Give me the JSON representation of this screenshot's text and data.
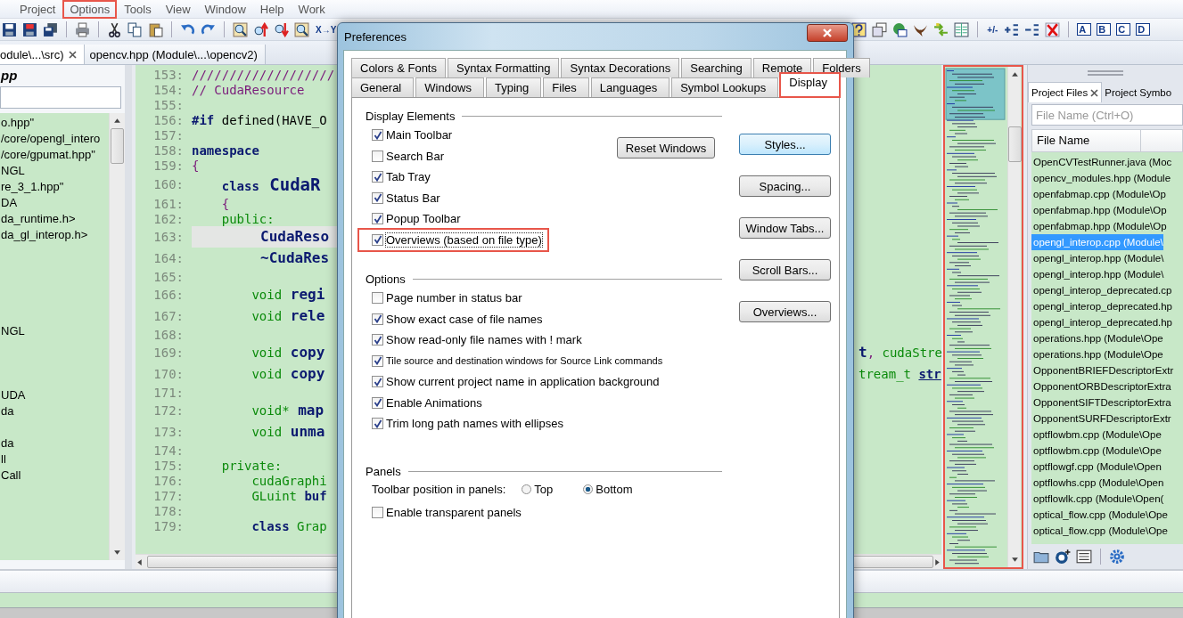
{
  "menu": [
    {
      "label": "Project",
      "highlighted": false
    },
    {
      "label": "Options",
      "highlighted": true
    },
    {
      "label": "Tools",
      "highlighted": false
    },
    {
      "label": "View",
      "highlighted": false
    },
    {
      "label": "Window",
      "highlighted": false
    },
    {
      "label": "Help",
      "highlighted": false
    },
    {
      "label": "Work",
      "highlighted": false
    }
  ],
  "toolbar": {
    "left": [
      {
        "kind": "floppy"
      },
      {
        "kind": "floppy-red"
      },
      {
        "kind": "floppies"
      },
      {
        "kind": "sep"
      },
      {
        "kind": "printer"
      },
      {
        "kind": "sep"
      },
      {
        "kind": "scissors"
      },
      {
        "kind": "copy"
      },
      {
        "kind": "paste"
      },
      {
        "kind": "sep"
      },
      {
        "kind": "undo"
      },
      {
        "kind": "redo"
      },
      {
        "kind": "sep"
      },
      {
        "kind": "find"
      },
      {
        "kind": "find-up"
      },
      {
        "kind": "find-down"
      },
      {
        "kind": "find"
      },
      {
        "kind": "label",
        "label": "X→Y"
      }
    ],
    "right": [
      {
        "kind": "help"
      },
      {
        "kind": "windows"
      },
      {
        "kind": "globe"
      },
      {
        "kind": "bird"
      },
      {
        "kind": "arrows"
      },
      {
        "kind": "columns"
      },
      {
        "kind": "sep"
      },
      {
        "kind": "label",
        "label": "+/-"
      },
      {
        "kind": "plus-list"
      },
      {
        "kind": "minus-list"
      },
      {
        "kind": "red-x"
      },
      {
        "kind": "sep"
      },
      {
        "kind": "letter",
        "label": "A"
      },
      {
        "kind": "letter",
        "label": "B"
      },
      {
        "kind": "letter",
        "label": "C"
      },
      {
        "kind": "letter",
        "label": "D"
      }
    ]
  },
  "file_tabs": [
    {
      "label": "odule\\...\\src)",
      "selected": true,
      "closable": true
    },
    {
      "label": "opencv.hpp (Module\\...\\opencv2)",
      "selected": false,
      "closable": false
    }
  ],
  "left_panel": {
    "title": "pp",
    "items": [
      {
        "kind": "entry",
        "text": "o.hpp\""
      },
      {
        "kind": "entry",
        "text": "/core/opengl_intero"
      },
      {
        "kind": "entry",
        "text": "/core/gpumat.hpp\""
      },
      {
        "kind": "entry",
        "text": "NGL"
      },
      {
        "kind": "entry",
        "text": "re_3_1.hpp\""
      },
      {
        "kind": "entry",
        "text": "DA"
      },
      {
        "kind": "entry",
        "text": "da_runtime.h>"
      },
      {
        "kind": "entry",
        "text": "da_gl_interop.h>"
      },
      {
        "kind": "offscreen"
      },
      {
        "kind": "offscreen"
      },
      {
        "kind": "offscreen"
      },
      {
        "kind": "offscreen"
      },
      {
        "kind": "offscreen"
      },
      {
        "kind": "entry",
        "text": "NGL"
      },
      {
        "kind": "offscreen"
      },
      {
        "kind": "offscreen"
      },
      {
        "kind": "offscreen"
      },
      {
        "kind": "entry",
        "text": "UDA"
      },
      {
        "kind": "entry",
        "text": "da"
      },
      {
        "kind": "offscreen"
      },
      {
        "kind": "entry",
        "text": "da"
      },
      {
        "kind": "entry",
        "text": "ll"
      },
      {
        "kind": "entry",
        "text": "Call"
      }
    ]
  },
  "editor": {
    "lines": [
      {
        "number": "153:",
        "segments": [
          {
            "kind": "comment",
            "text": "///////////////////"
          }
        ]
      },
      {
        "number": "154:",
        "segments": [
          {
            "kind": "comment",
            "text": "// CudaResource"
          }
        ]
      },
      {
        "number": "155:"
      },
      {
        "number": "156:",
        "segments": [
          {
            "kind": "keyword",
            "text": "#if"
          },
          {
            "kind": "plain",
            "text": " defined(HAVE_O"
          }
        ]
      },
      {
        "number": "157:"
      },
      {
        "number": "158:",
        "segments": [
          {
            "kind": "keyword",
            "text": "namespace"
          }
        ]
      },
      {
        "number": "159:",
        "segments": [
          {
            "kind": "comment",
            "text": "{"
          }
        ]
      },
      {
        "number": "160:",
        "segments": [
          {
            "kind": "keyword",
            "text": "    class"
          },
          {
            "kind": "title",
            "text": " CudaR"
          }
        ]
      },
      {
        "number": "161:",
        "segments": [
          {
            "kind": "comment",
            "text": "    {"
          }
        ]
      },
      {
        "number": "162:",
        "segments": [
          {
            "kind": "type",
            "text": "    public:"
          }
        ]
      },
      {
        "number": "163:",
        "current": true,
        "segments": [
          {
            "kind": "big",
            "text": "        CudaReso"
          }
        ]
      },
      {
        "number": "164:",
        "segments": [
          {
            "kind": "big",
            "text": "        ~CudaRes"
          }
        ]
      },
      {
        "number": "165:"
      },
      {
        "number": "166:",
        "segments": [
          {
            "kind": "type",
            "text": "        void"
          },
          {
            "kind": "big",
            "text": " regi"
          }
        ]
      },
      {
        "number": "167:",
        "segments": [
          {
            "kind": "type",
            "text": "        void"
          },
          {
            "kind": "big",
            "text": " rele"
          }
        ]
      },
      {
        "number": "168:"
      },
      {
        "number": "169:",
        "segments": [
          {
            "kind": "type",
            "text": "        void"
          },
          {
            "kind": "big",
            "text": " copy"
          }
        ],
        "right_segments": [
          {
            "kind": "big",
            "text": "t"
          },
          {
            "kind": "comment",
            "text": ","
          },
          {
            "kind": "type",
            "text": " cudaStre"
          }
        ]
      },
      {
        "number": "170:",
        "segments": [
          {
            "kind": "type",
            "text": "        void"
          },
          {
            "kind": "big",
            "text": " copy"
          }
        ],
        "right_segments": [
          {
            "kind": "type",
            "text": "tream_t "
          },
          {
            "kind": "link",
            "text": "str"
          }
        ]
      },
      {
        "number": "171:"
      },
      {
        "number": "172:",
        "segments": [
          {
            "kind": "type",
            "text": "        void*"
          },
          {
            "kind": "big",
            "text": " map"
          }
        ]
      },
      {
        "number": "173:",
        "segments": [
          {
            "kind": "type",
            "text": "        void"
          },
          {
            "kind": "big",
            "text": " unma"
          }
        ]
      },
      {
        "number": "174:"
      },
      {
        "number": "175:",
        "segments": [
          {
            "kind": "type",
            "text": "    private:"
          }
        ]
      },
      {
        "number": "176:",
        "segments": [
          {
            "kind": "type",
            "text": "        cudaGraphi"
          }
        ]
      },
      {
        "number": "177:",
        "segments": [
          {
            "kind": "type",
            "text": "        GLuint"
          },
          {
            "kind": "keyword",
            "text": " buf"
          }
        ]
      },
      {
        "number": "178:"
      },
      {
        "number": "179:",
        "segments": [
          {
            "kind": "keyword",
            "text": "        class"
          },
          {
            "kind": "type",
            "text": " Grap"
          }
        ]
      }
    ]
  },
  "overview": {
    "highlighted": true
  },
  "project_panel": {
    "tabs": [
      {
        "label": "Project Files",
        "selected": true,
        "closable": true
      },
      {
        "label": "Project Symbo",
        "selected": false,
        "closable": false
      }
    ],
    "search": {
      "placeholder": "File Name (Ctrl+O)"
    },
    "columns": [
      "File Name"
    ],
    "rows": [
      {
        "text": "OpenCVTestRunner.java (Moc",
        "selected": false
      },
      {
        "text": "opencv_modules.hpp (Module",
        "selected": false
      },
      {
        "text": "openfabmap.cpp (Module\\Op",
        "selected": false
      },
      {
        "text": "openfabmap.hpp (Module\\Op",
        "selected": false
      },
      {
        "text": "openfabmap.hpp (Module\\Op",
        "selected": false
      },
      {
        "text": "opengl_interop.cpp (Module\\",
        "selected": true
      },
      {
        "text": "opengl_interop.hpp (Module\\",
        "selected": false
      },
      {
        "text": "opengl_interop.hpp (Module\\",
        "selected": false
      },
      {
        "text": "opengl_interop_deprecated.cp",
        "selected": false
      },
      {
        "text": "opengl_interop_deprecated.hp",
        "selected": false
      },
      {
        "text": "opengl_interop_deprecated.hp",
        "selected": false
      },
      {
        "text": "operations.hpp (Module\\Ope",
        "selected": false
      },
      {
        "text": "operations.hpp (Module\\Ope",
        "selected": false
      },
      {
        "text": "OpponentBRIEFDescriptorExtr",
        "selected": false
      },
      {
        "text": "OpponentORBDescriptorExtra",
        "selected": false
      },
      {
        "text": "OpponentSIFTDescriptorExtra",
        "selected": false
      },
      {
        "text": "OpponentSURFDescriptorExtr",
        "selected": false
      },
      {
        "text": "optflowbm.cpp (Module\\Ope",
        "selected": false
      },
      {
        "text": "optflowbm.cpp (Module\\Ope",
        "selected": false
      },
      {
        "text": "optflowgf.cpp (Module\\Open",
        "selected": false
      },
      {
        "text": "optflowhs.cpp (Module\\Open",
        "selected": false
      },
      {
        "text": "optflowlk.cpp (Module\\Open(",
        "selected": false
      },
      {
        "text": "optical_flow.cpp (Module\\Ope",
        "selected": false
      },
      {
        "text": "optical_flow.cpp (Module\\Ope",
        "selected": false
      }
    ],
    "tools": [
      {
        "kind": "folder"
      },
      {
        "kind": "project-add"
      },
      {
        "kind": "list"
      },
      {
        "kind": "sep"
      },
      {
        "kind": "gear"
      }
    ]
  },
  "dialog": {
    "title": "Preferences",
    "tab_rows": [
      [
        {
          "label": "Colors & Fonts",
          "selected": false,
          "highlighted": false
        },
        {
          "label": "Syntax Formatting",
          "selected": false,
          "highlighted": false
        },
        {
          "label": "Syntax Decorations",
          "selected": false,
          "highlighted": false
        },
        {
          "label": "Searching",
          "selected": false,
          "highlighted": false
        },
        {
          "label": "Remote",
          "selected": false,
          "highlighted": false
        },
        {
          "label": "Folders",
          "selected": false,
          "highlighted": false
        }
      ],
      [
        {
          "label": "General",
          "selected": false,
          "highlighted": false
        },
        {
          "label": "Windows",
          "selected": false,
          "highlighted": false
        },
        {
          "label": "Typing",
          "selected": false,
          "highlighted": false
        },
        {
          "label": "Files",
          "selected": false,
          "highlighted": false
        },
        {
          "label": "Languages",
          "selected": false,
          "highlighted": false
        },
        {
          "label": "Symbol Lookups",
          "selected": false,
          "highlighted": false
        },
        {
          "label": "Display",
          "selected": true,
          "highlighted": true
        }
      ]
    ],
    "display_elements": {
      "title": "Display Elements",
      "reset_button": "Reset Windows",
      "items": [
        {
          "label": "Main Toolbar",
          "checked": true,
          "highlighted": false,
          "focused": false
        },
        {
          "label": "Search Bar",
          "checked": false,
          "highlighted": false,
          "focused": false
        },
        {
          "label": "Tab Tray",
          "checked": true,
          "highlighted": false,
          "focused": false
        },
        {
          "label": "Status Bar",
          "checked": true,
          "highlighted": false,
          "focused": false
        },
        {
          "label": "Popup Toolbar",
          "checked": true,
          "highlighted": false,
          "focused": false
        },
        {
          "label": "Overviews (based on file type)",
          "checked": true,
          "highlighted": true,
          "focused": true
        }
      ]
    },
    "options": {
      "title": "Options",
      "items": [
        {
          "label": "Page number in status bar",
          "checked": false
        },
        {
          "label": "Show exact case of file names",
          "checked": true
        },
        {
          "label": "Show read-only file names with ! mark",
          "checked": true
        },
        {
          "label": "Tile source and destination windows for Source Link commands",
          "checked": true
        },
        {
          "label": "Show current project name in application background",
          "checked": true
        },
        {
          "label": "Enable Animations",
          "checked": true
        },
        {
          "label": "Trim long path names with ellipses",
          "checked": true
        }
      ]
    },
    "panels": {
      "title": "Panels",
      "radio_label": "Toolbar position in panels:",
      "radios": [
        {
          "label": "Top",
          "selected": false
        },
        {
          "label": "Bottom",
          "selected": true
        }
      ],
      "items": [
        {
          "label": "Enable transparent panels",
          "checked": false
        }
      ]
    },
    "buttons": [
      {
        "label": "Styles...",
        "default": true
      },
      {
        "label": "Spacing...",
        "default": false
      },
      {
        "label": "Window Tabs...",
        "default": false
      },
      {
        "label": "Scroll Bars...",
        "default": false
      },
      {
        "label": "Overviews...",
        "default": false
      }
    ]
  }
}
